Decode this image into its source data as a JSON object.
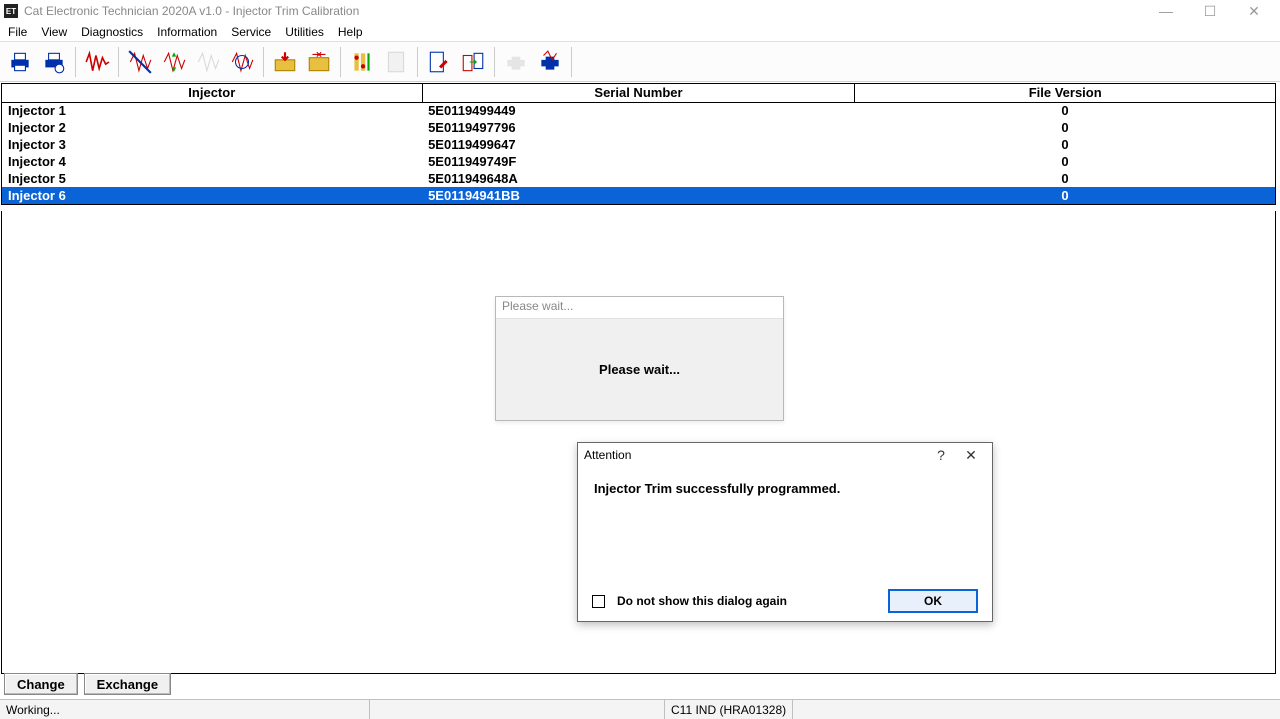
{
  "app": {
    "icon_label": "ET",
    "title": "Cat Electronic Technician 2020A v1.0 - Injector Trim Calibration"
  },
  "menu": [
    "File",
    "View",
    "Diagnostics",
    "Information",
    "Service",
    "Utilities",
    "Help"
  ],
  "columns": [
    "Injector",
    "Serial Number",
    "File Version"
  ],
  "rows": [
    {
      "injector": "Injector 1",
      "serial": "5E0119499449",
      "version": "0",
      "selected": false
    },
    {
      "injector": "Injector 2",
      "serial": "5E0119497796",
      "version": "0",
      "selected": false
    },
    {
      "injector": "Injector 3",
      "serial": "5E0119499647",
      "version": "0",
      "selected": false
    },
    {
      "injector": "Injector 4",
      "serial": "5E011949749F",
      "version": "0",
      "selected": false
    },
    {
      "injector": "Injector 5",
      "serial": "5E011949648A",
      "version": "0",
      "selected": false
    },
    {
      "injector": "Injector 6",
      "serial": "5E01194941BB",
      "version": "0",
      "selected": true
    }
  ],
  "wait_dialog": {
    "title": "Please wait...",
    "message": "Please wait..."
  },
  "attention_dialog": {
    "title": "Attention",
    "message": "Injector Trim successfully programmed.",
    "checkbox_label": "Do not show this dialog again",
    "ok_label": "OK"
  },
  "footer": {
    "change": "Change",
    "exchange": "Exchange"
  },
  "status": {
    "left": "Working...",
    "device": "C11 IND (HRA01328)"
  }
}
